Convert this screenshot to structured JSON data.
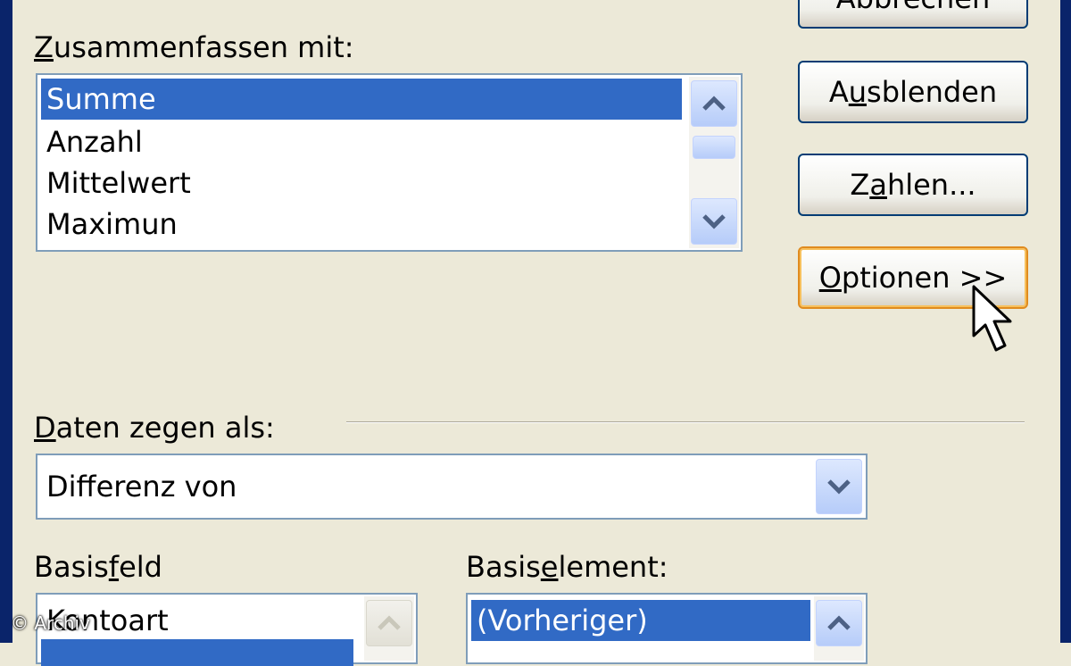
{
  "buttons": {
    "cancel": "Abbrechen",
    "hide_prefix": "A",
    "hide_mnemonic": "u",
    "hide_suffix": "sblenden",
    "numbers_prefix": "Z",
    "numbers_mnemonic": "a",
    "numbers_suffix": "hlen...",
    "options_prefix": "",
    "options_mnemonic": "O",
    "options_suffix": "ptionen >>"
  },
  "summarize": {
    "label_mnemonic": "Z",
    "label_rest": "usammenfassen mit:",
    "items": [
      "Summe",
      "Anzahl",
      "Mittelwert",
      "Maximun"
    ],
    "selected_index": 0
  },
  "show_as": {
    "label_mnemonic": "D",
    "label_rest": "aten zegen als:",
    "value": "Differenz von"
  },
  "base_field": {
    "label_prefix": "Basis",
    "label_mnemonic": "f",
    "label_suffix": "eld",
    "items": [
      "Kontoart"
    ]
  },
  "base_item": {
    "label_prefix": "Basis",
    "label_mnemonic": "e",
    "label_suffix": "lement:",
    "items": [
      "(Vorheriger)"
    ],
    "selected_index": 0
  },
  "watermark": "© Archiv",
  "colors": {
    "dialog_bg": "#ece9d8",
    "selection": "#316ac5",
    "focus_border": "#e08b1e",
    "window_frame": "#0a246a"
  },
  "icons": {
    "scroll_up": "chevron-up-icon",
    "scroll_down": "chevron-down-icon",
    "combo_drop": "chevron-down-icon",
    "cursor": "mouse-pointer-icon"
  }
}
